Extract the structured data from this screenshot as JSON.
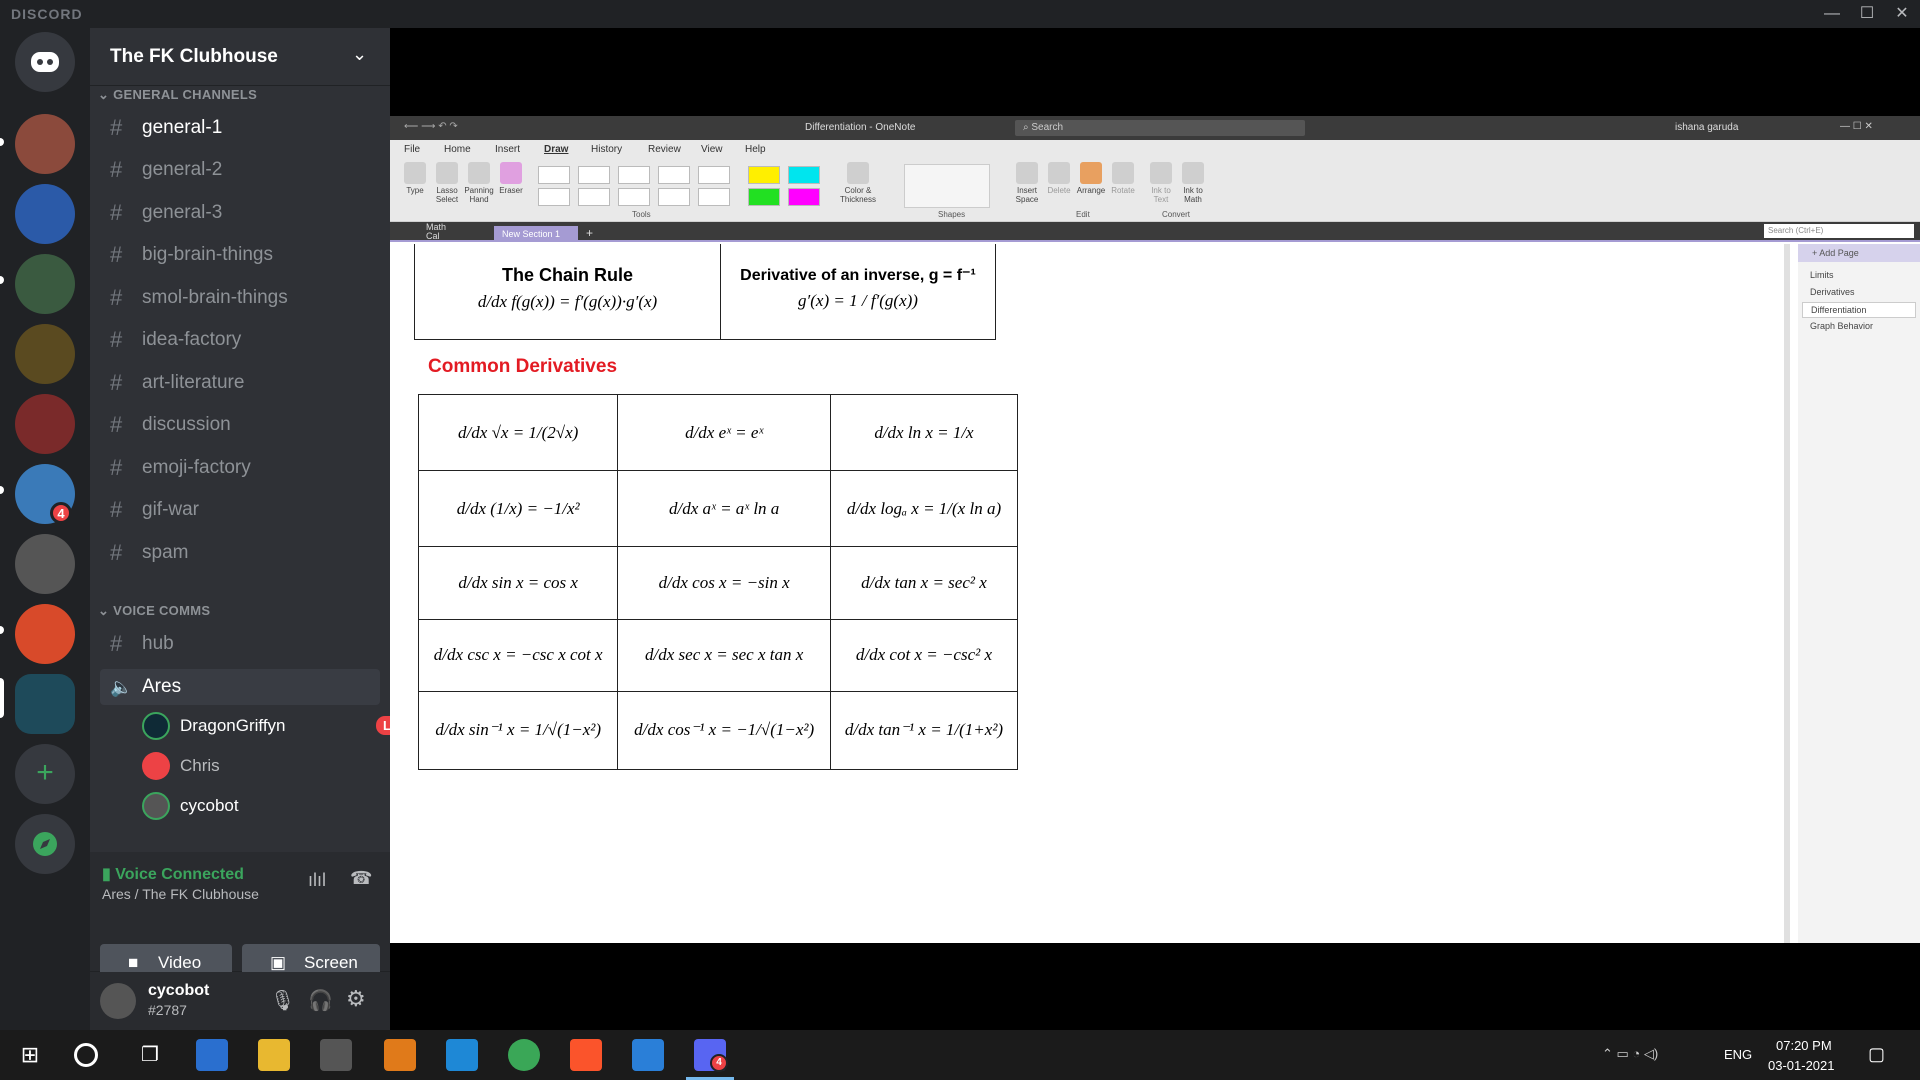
{
  "app": {
    "brand": "DISCORD"
  },
  "servers": {
    "badge_count": "4"
  },
  "guild": {
    "name": "The FK Clubhouse"
  },
  "categories": {
    "general": "GENERAL CHANNELS",
    "voice": "VOICE COMMS"
  },
  "channels": [
    "general-1",
    "general-2",
    "general-3",
    "big-brain-things",
    "smol-brain-things",
    "idea-factory",
    "art-literature",
    "discussion",
    "emoji-factory",
    "gif-war",
    "spam"
  ],
  "voice_channels": {
    "hub": "hub",
    "ares": "Ares"
  },
  "voice_users": [
    {
      "name": "DragonGriffyn",
      "live": "LIVE"
    },
    {
      "name": "Chris"
    },
    {
      "name": "cycobot"
    }
  ],
  "voice_panel": {
    "status": "Voice Connected",
    "location": "Ares / The FK Clubhouse",
    "video_label": "Video",
    "screen_label": "Screen"
  },
  "user_panel": {
    "username": "cycobot",
    "tag": "#2787"
  },
  "onenote": {
    "title": "Differentiation - OneNote",
    "search_placeholder": "Search",
    "user": "ishana garuda",
    "menu": [
      "File",
      "Home",
      "Insert",
      "Draw",
      "History",
      "Review",
      "View",
      "Help"
    ],
    "ribbon": {
      "type": "Type",
      "lasso": "Lasso Select",
      "panning": "Panning Hand",
      "eraser": "Eraser",
      "color": "Color & Thickness",
      "insert_space": "Insert Space",
      "delete": "Delete",
      "arrange": "Arrange",
      "rotate": "Rotate",
      "ink_text": "Ink to Text",
      "ink_math": "Ink to Math",
      "groups": [
        "Tools",
        "Shapes",
        "Edit",
        "Convert"
      ]
    },
    "notebook": "Math Cal",
    "section": "New Section 1",
    "search_pages": "Search (Ctrl+E)",
    "add_page": "Add Page",
    "pages": [
      "Limits",
      "Derivatives",
      "Differentiation",
      "Graph Behavior"
    ],
    "content": {
      "chain_rule_title": "The Chain Rule",
      "chain_rule_formula": "d/dx f(g(x)) = f′(g(x))·g′(x)",
      "inverse_title": "Derivative of an inverse, g = f⁻¹",
      "inverse_formula": "g′(x) = 1 / f′(g(x))",
      "common_title": "Common Derivatives",
      "table": [
        [
          "d/dx √x = 1/(2√x)",
          "d/dx eˣ = eˣ",
          "d/dx ln x = 1/x"
        ],
        [
          "d/dx (1/x) = −1/x²",
          "d/dx aˣ = aˣ ln a",
          "d/dx logₐ x = 1/(x ln a)"
        ],
        [
          "d/dx sin x = cos x",
          "d/dx cos x = −sin x",
          "d/dx tan x = sec² x"
        ],
        [
          "d/dx csc x = −csc x cot x",
          "d/dx sec x = sec x tan x",
          "d/dx cot x = −csc² x"
        ],
        [
          "d/dx sin⁻¹ x = 1/√(1−x²)",
          "d/dx cos⁻¹ x = −1/√(1−x²)",
          "d/dx tan⁻¹ x = 1/(1+x²)"
        ]
      ]
    }
  },
  "taskbar": {
    "lang": "ENG",
    "time": "07:20 PM",
    "date": "03-01-2021",
    "badge": "4"
  },
  "colors": {
    "accent": "#5865f2",
    "green": "#3ba55d",
    "red": "#ed4245"
  }
}
